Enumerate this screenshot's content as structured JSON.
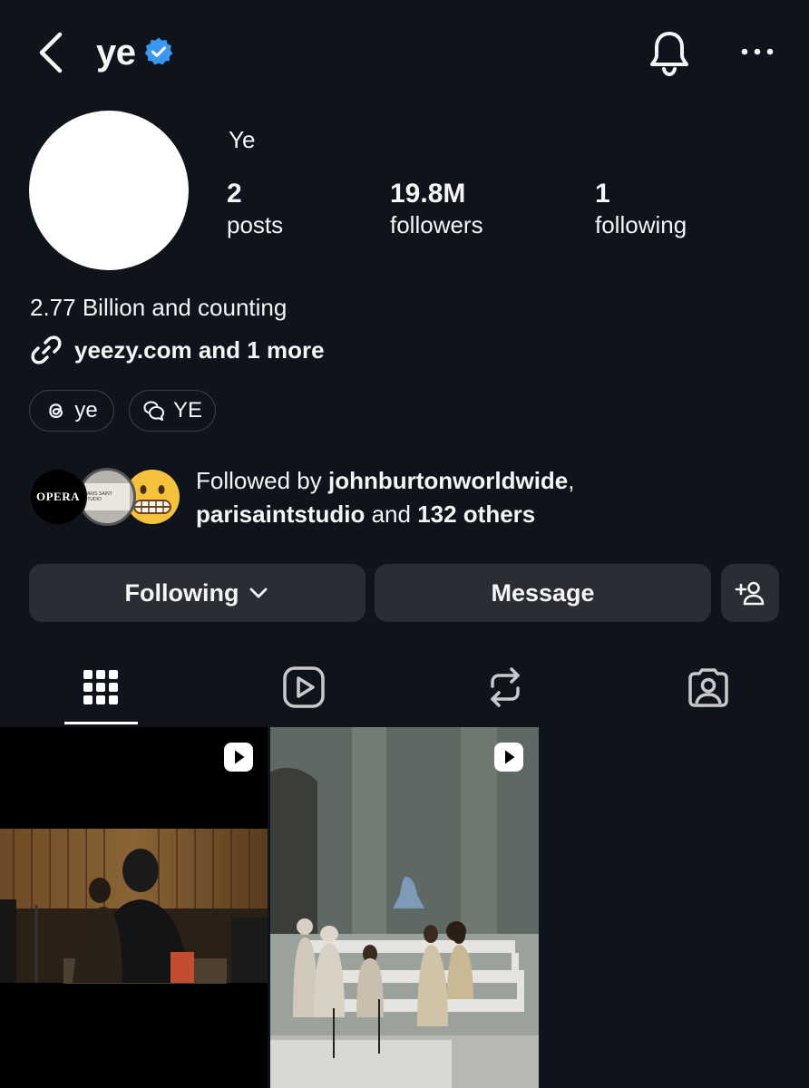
{
  "header": {
    "username": "ye",
    "icons": {
      "back": "chevron-left-icon",
      "verified": "verified-badge-icon",
      "bell": "bell-icon",
      "more": "more-horizontal-icon"
    },
    "verified_color": "#3897f0"
  },
  "profile": {
    "display_name": "Ye",
    "stats": {
      "posts": {
        "value": "2",
        "label": "posts"
      },
      "followers": {
        "value": "19.8M",
        "label": "followers"
      },
      "following": {
        "value": "1",
        "label": "following"
      }
    },
    "bio": "2.77 Billion and counting",
    "link": "yeezy.com and 1 more",
    "chips": [
      {
        "label": "ye",
        "icon": "threads-icon"
      },
      {
        "label": "YE",
        "icon": "chat-bubbles-icon"
      }
    ]
  },
  "followed_by": {
    "prefix": "Followed by ",
    "user1": "johnburtonworldwide",
    "sep": ",",
    "user2": "parisaintstudio",
    "and": " and ",
    "others": "132 others",
    "avatars": [
      {
        "label": "OPERA"
      },
      {
        "label": "PARIS SAINT STUDIO"
      },
      {
        "emoji": "😬"
      }
    ]
  },
  "actions": {
    "following": "Following",
    "message": "Message",
    "add_user_icon": "add-user-icon"
  },
  "tabs": [
    "grid-icon",
    "reels-icon",
    "reposts-icon",
    "tagged-icon"
  ],
  "posts": [
    {
      "type": "reel",
      "description": "studio"
    },
    {
      "type": "reel",
      "description": "church"
    }
  ]
}
